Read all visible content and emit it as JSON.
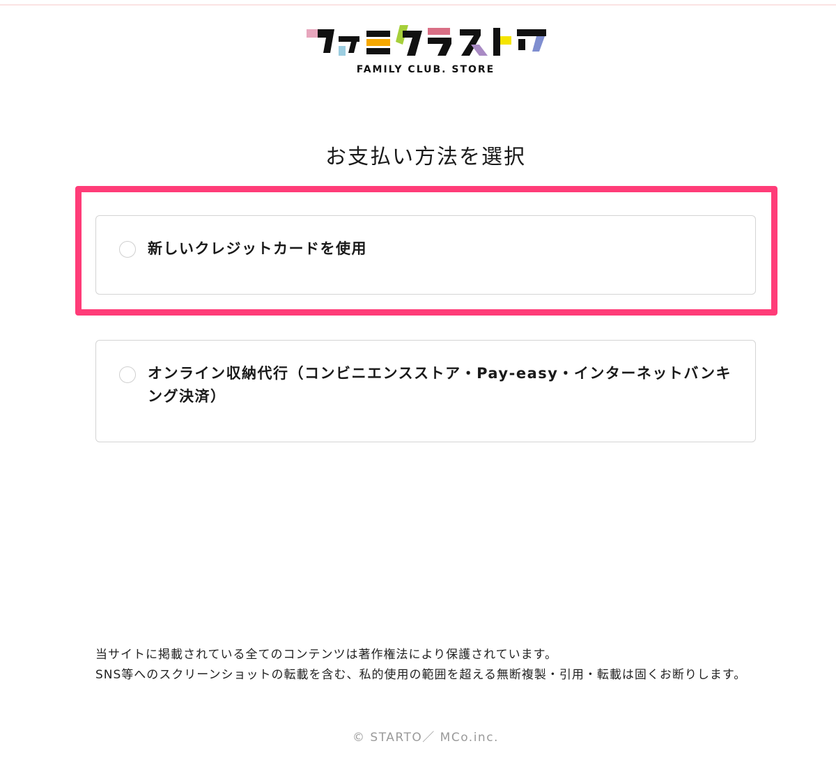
{
  "brand": {
    "logo_text": "ファミクラストア",
    "logo_subtitle": "FAMILY CLUB. STORE"
  },
  "page": {
    "title": "お支払い方法を選択"
  },
  "payment_options": [
    {
      "label": "新しいクレジットカードを使用",
      "selected": false,
      "highlighted": true
    },
    {
      "label": "オンライン収納代行（コンビニエンスストア・Pay-easy・インターネットバンキング決済）",
      "selected": false,
      "highlighted": false
    }
  ],
  "footer": {
    "notice_line1": "当サイトに掲載されている全てのコンテンツは著作権法により保護されています。",
    "notice_line2": "SNS等へのスクリーンショットの転載を含む、私的使用の範囲を超える無断複製・引用・転載は固くお断りします。",
    "copyright": "© STARTO／ MCo.inc."
  },
  "colors": {
    "highlight": "#ff3c78",
    "card_border": "#d4d4d4",
    "logo_pink": "#e7a6bd",
    "logo_blue": "#9ccde0",
    "logo_orange": "#f6a800",
    "logo_green": "#a6cf3a",
    "logo_rose": "#d96f85",
    "logo_purple": "#a98bc4",
    "logo_yellow": "#f5e400",
    "logo_periwinkle": "#7f8ed0"
  }
}
